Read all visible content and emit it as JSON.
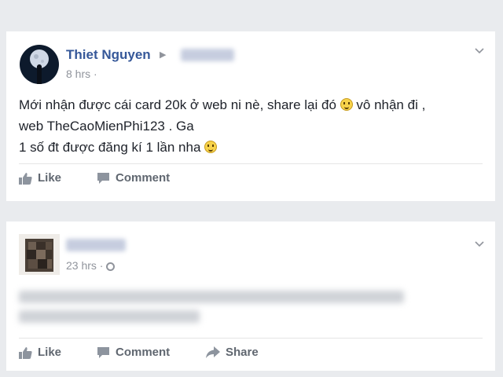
{
  "post1": {
    "author": "Thiet Nguyen",
    "time": "8 hrs ·",
    "lines": [
      "Mới nhận được cái card 20k ở web ni nè, share lại đó",
      "vô nhận đi ,",
      "web TheCaoMienPhi123 . Ga",
      "1 số đt được đăng kí 1 lần nha"
    ],
    "actions": {
      "like": "Like",
      "comment": "Comment"
    }
  },
  "post2": {
    "time": "23 hrs ·",
    "actions": {
      "like": "Like",
      "comment": "Comment",
      "share": "Share"
    }
  },
  "colors": {
    "link": "#365899",
    "meta": "#90949c",
    "action": "#606770",
    "background": "#e9ebee"
  }
}
